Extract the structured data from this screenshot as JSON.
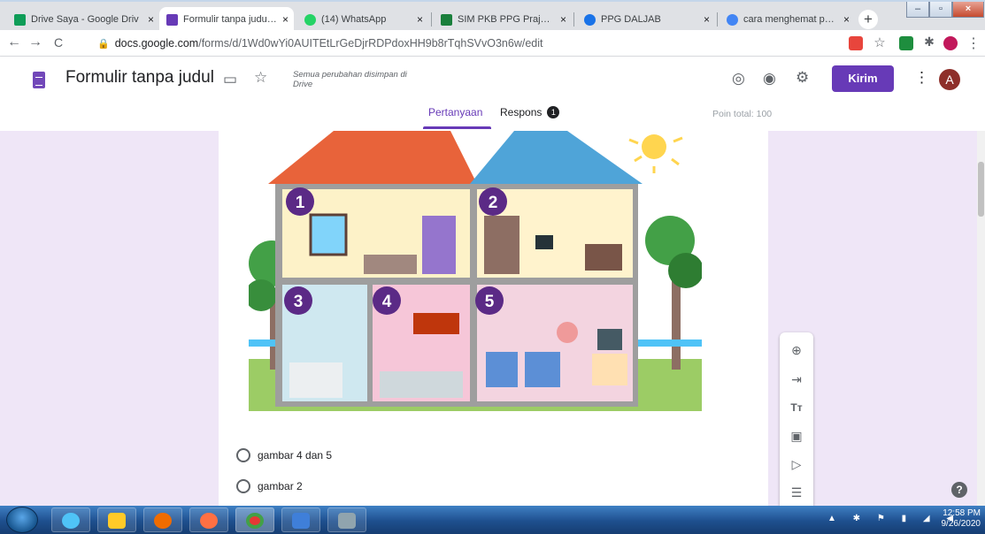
{
  "browser": {
    "tabs": [
      {
        "title": "Drive Saya - Google Driv",
        "color": "#0f9d58",
        "active": false
      },
      {
        "title": "Formulir tanpa judul - G",
        "color": "#673ab7",
        "active": true
      },
      {
        "title": "(14) WhatsApp",
        "color": "#25d366",
        "active": false
      },
      {
        "title": "SIM PKB PPG Prajabatan",
        "color": "#1a7f3c",
        "active": false
      },
      {
        "title": "PPG DALJAB",
        "color": "#1a73e8",
        "active": false
      },
      {
        "title": "cara menghemat pemak",
        "color": "#4285f4",
        "active": false
      }
    ],
    "close_glyph": "×",
    "new_tab": "+",
    "url_domain": "docs.google.com",
    "url_path": "/forms/d/1Wd0wYi0AUITEtLrGeDjrRDPdoxHH9b8rTqhSVvO3n6w/edit",
    "back": "←",
    "forward": "→",
    "reload": "C",
    "star": "☆",
    "menu": "⋮"
  },
  "form_header": {
    "title": "Formulir tanpa judul",
    "saved_status": "Semua perubahan disimpan di Drive",
    "send_label": "Kirim",
    "avatar_letter": "A",
    "tab_questions": "Pertanyaan",
    "tab_responses": "Respons",
    "responses_count": "1",
    "total_points": "Poin total: 100"
  },
  "question": {
    "room_numbers": [
      "1",
      "2",
      "3",
      "4",
      "5"
    ],
    "options": [
      "gambar 4 dan 5",
      "gambar 2"
    ]
  },
  "toolbar_icons": [
    "add-question-icon",
    "import-questions-icon",
    "add-title-icon",
    "add-image-icon",
    "add-video-icon",
    "add-section-icon"
  ],
  "help": "?",
  "taskbar": {
    "time": "12:58 PM",
    "date": "9/26/2020"
  },
  "colors": {
    "accent": "#673ab7",
    "background": "#efe6f7",
    "roof": "#e8633a",
    "wall": "#f3c9d9"
  }
}
